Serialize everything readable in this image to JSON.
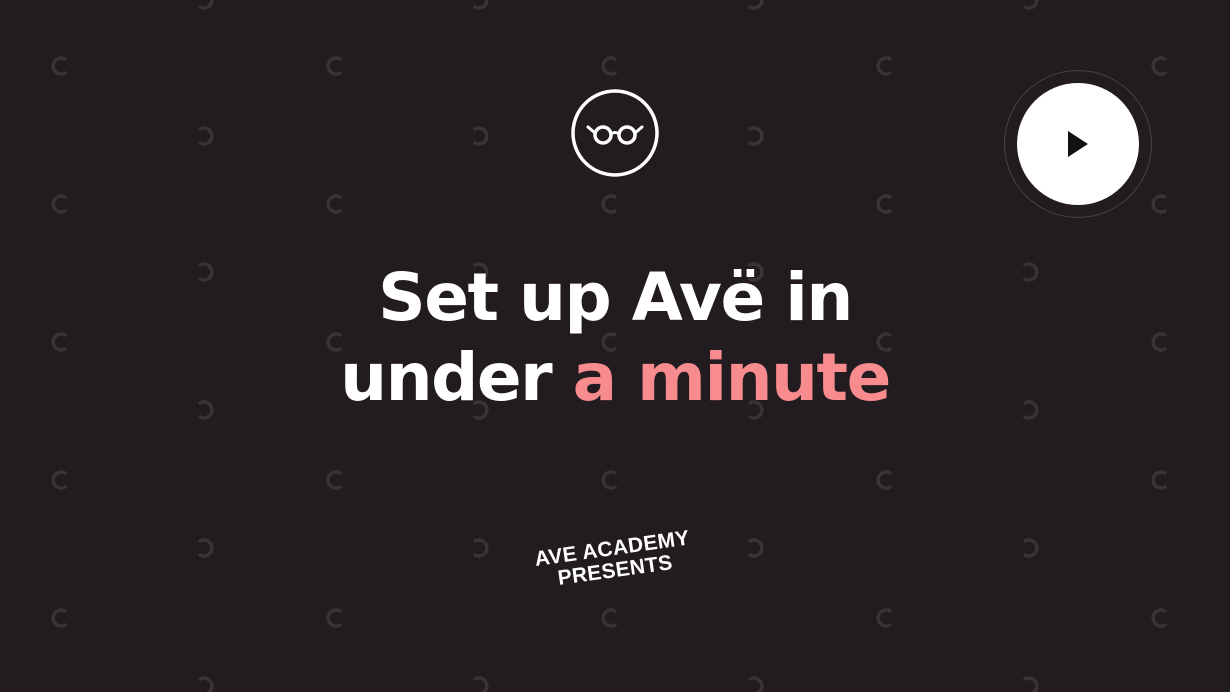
{
  "video": {
    "headline": {
      "line1": "Set up Avë in",
      "line2_plain": "under",
      "line2_accent": "a minute"
    },
    "presents": {
      "line1": "AVE ACADEMY",
      "line2": "PRESENTS"
    },
    "play_icon": "play-icon",
    "logo_icon": "glasses-icon"
  },
  "colors": {
    "background": "#221b20",
    "text": "#ffffff",
    "accent": "#f78b8d",
    "pattern": "#3b3238"
  }
}
